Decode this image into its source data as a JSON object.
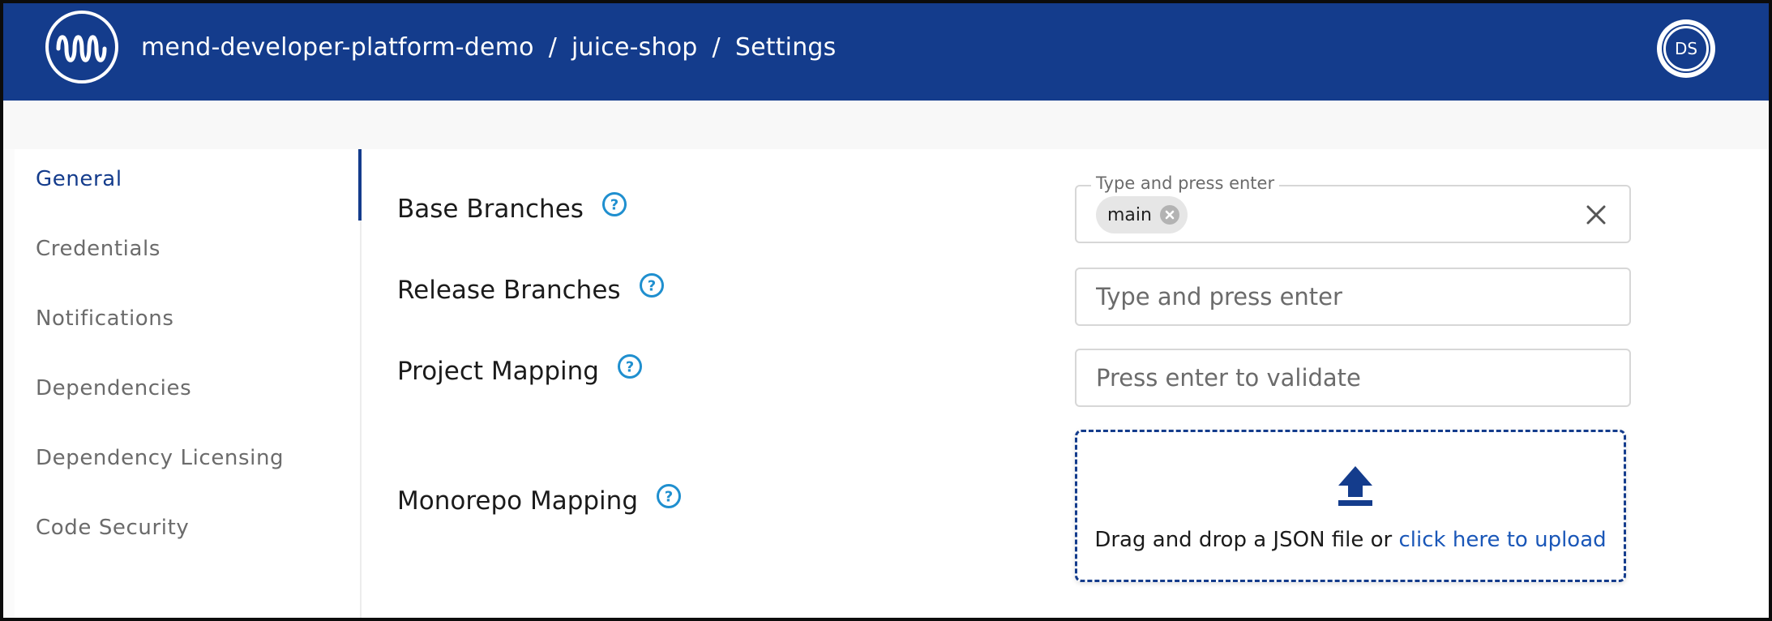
{
  "header": {
    "breadcrumb": [
      "mend-developer-platform-demo",
      "juice-shop",
      "Settings"
    ],
    "avatar_initials": "DS",
    "brand_color": "#143c8c"
  },
  "sidebar": {
    "items": [
      {
        "label": "General",
        "active": true
      },
      {
        "label": "Credentials",
        "active": false
      },
      {
        "label": "Notifications",
        "active": false
      },
      {
        "label": "Dependencies",
        "active": false
      },
      {
        "label": "Dependency Licensing",
        "active": false
      },
      {
        "label": "Code Security",
        "active": false
      }
    ]
  },
  "settings": {
    "base_branches": {
      "label": "Base Branches",
      "legend": "Type and press enter",
      "chips": [
        "main"
      ]
    },
    "release_branches": {
      "label": "Release Branches",
      "placeholder": "Type and press enter"
    },
    "project_mapping": {
      "label": "Project Mapping",
      "placeholder": "Press enter to validate"
    },
    "monorepo_mapping": {
      "label": "Monorepo Mapping",
      "dropzone_text": "Drag and drop a JSON file or ",
      "dropzone_link": "click here to upload"
    }
  },
  "icons": {
    "help": "help-circle-icon",
    "upload": "upload-icon",
    "clear": "close-icon",
    "chip_remove": "chip-remove-icon",
    "logo": "mend-logo-icon"
  },
  "colors": {
    "accent": "#143c8c",
    "help_icon": "#1f8fcf",
    "link": "#1a57b8"
  }
}
